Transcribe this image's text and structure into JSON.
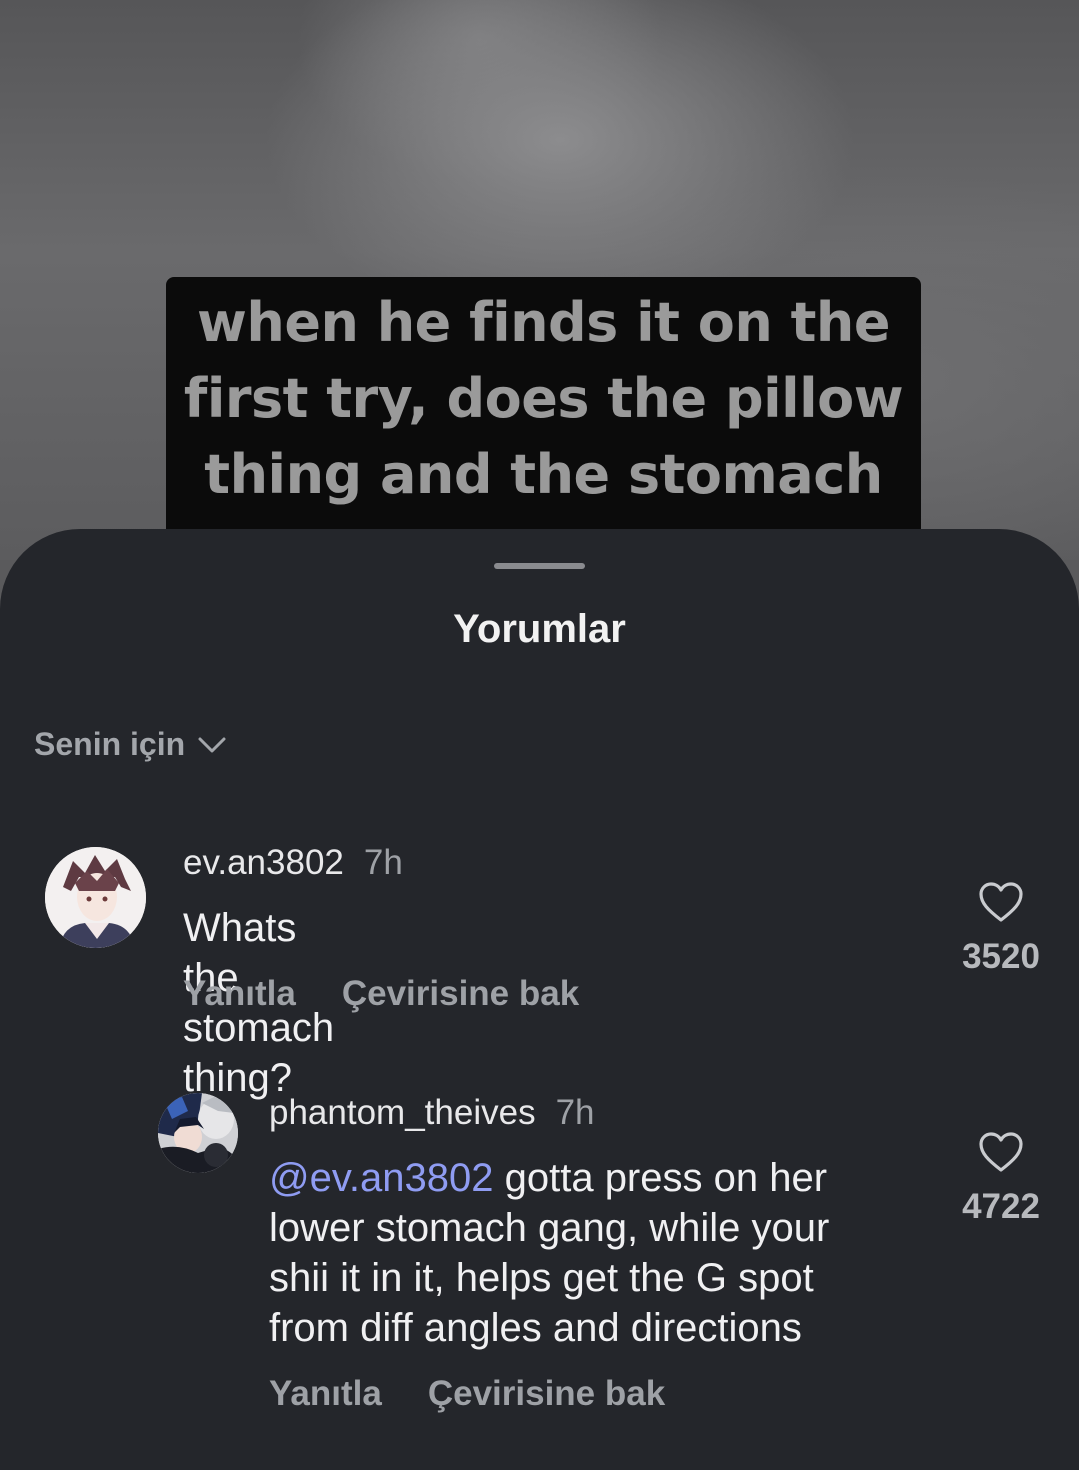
{
  "video": {
    "caption_lines": [
      "when he finds it on the",
      "first try, does the pillow",
      "thing and the stomach"
    ]
  },
  "sheet": {
    "title": "Yorumlar",
    "sort_label": "Senin için"
  },
  "comments": [
    {
      "username": "ev.an3802",
      "time": "7h",
      "text": "Whats the stomach thing?",
      "reply_label": "Yanıtla",
      "translate_label": "Çevirisine bak",
      "likes": "3520"
    },
    {
      "username": "phantom_theives",
      "time": "7h",
      "mention": "@ev.an3802",
      "text_lines": [
        "gotta press on her",
        "lower stomach gang, while your",
        "shii it in it, helps get the G spot",
        "from diff angles and directions"
      ],
      "reply_label": "Yanıtla",
      "translate_label": "Çevirisine bak",
      "likes": "4722"
    }
  ]
}
